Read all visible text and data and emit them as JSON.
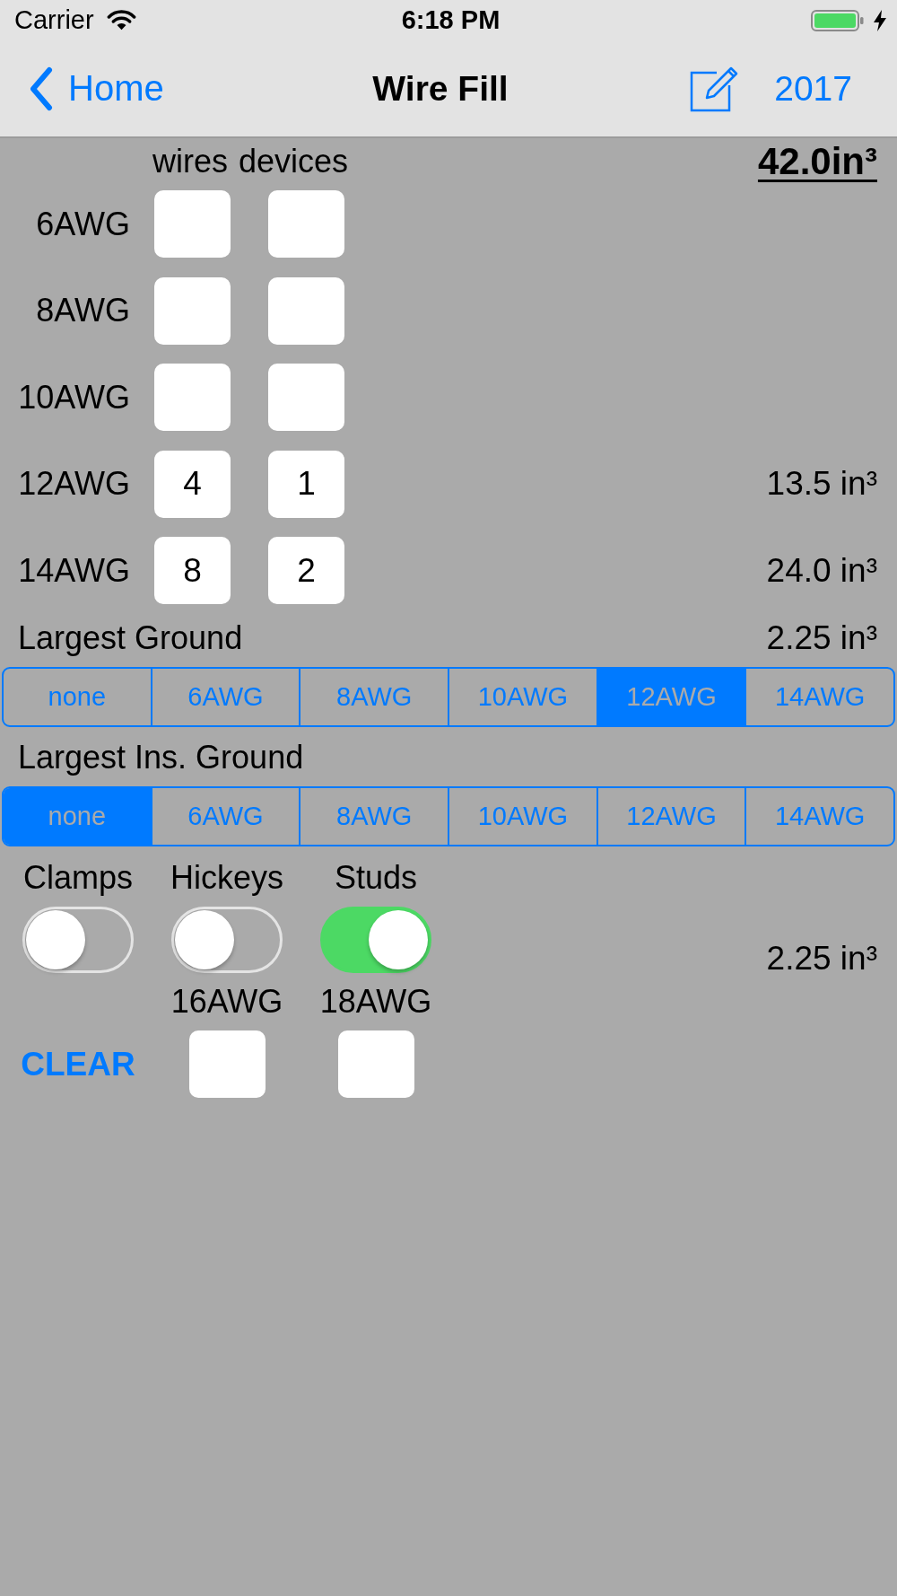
{
  "status_bar": {
    "carrier": "Carrier",
    "time": "6:18 PM"
  },
  "nav_bar": {
    "back": "Home",
    "title": "Wire Fill",
    "year": "2017"
  },
  "wire_table": {
    "columns": [
      "wires",
      "devices"
    ],
    "total": "42.0in³",
    "rows": [
      {
        "size": "6AWG"
      },
      {
        "size": "8AWG"
      },
      {
        "size": "10AWG"
      },
      {
        "size": "12AWG",
        "wires": "4",
        "devices": "1",
        "volume": "13.5 in³"
      },
      {
        "size": "14AWG",
        "wires": "8",
        "devices": "2",
        "volume": "24.0 in³"
      }
    ]
  },
  "largest_ground": {
    "label": "Largest Ground",
    "volume": "2.25 in³",
    "options": [
      {
        "label": "none",
        "selected": false
      },
      {
        "label": "6AWG",
        "selected": false
      },
      {
        "label": "8AWG",
        "selected": false
      },
      {
        "label": "10AWG",
        "selected": false
      },
      {
        "label": "12AWG",
        "selected": true
      },
      {
        "label": "14AWG",
        "selected": false
      }
    ]
  },
  "largest_ins_ground": {
    "label": "Largest Ins. Ground",
    "options": [
      {
        "label": "none",
        "selected": true
      },
      {
        "label": "6AWG",
        "selected": false
      },
      {
        "label": "8AWG",
        "selected": false
      },
      {
        "label": "10AWG",
        "selected": false
      },
      {
        "label": "12AWG",
        "selected": false
      },
      {
        "label": "14AWG",
        "selected": false
      }
    ]
  },
  "fittings": {
    "toggles": [
      {
        "label": "Clamps",
        "on": false
      },
      {
        "label": "Hickeys",
        "on": false
      },
      {
        "label": "Studs",
        "on": true
      }
    ],
    "volume": "2.25 in³",
    "small_wires": [
      {
        "size": "16AWG"
      },
      {
        "size": "18AWG"
      }
    ],
    "clear_button": "CLEAR"
  }
}
